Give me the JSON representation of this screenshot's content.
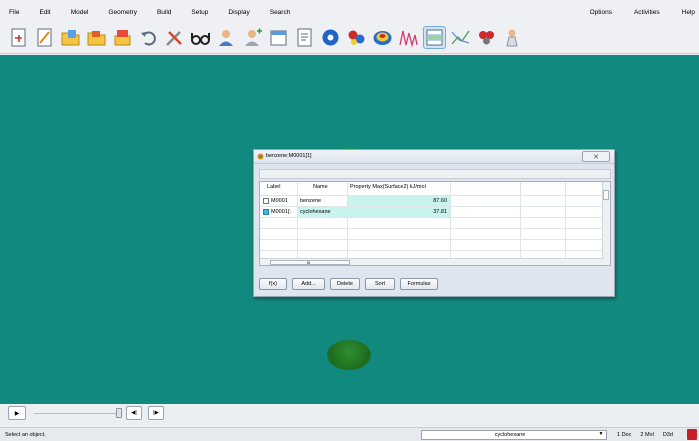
{
  "menu": {
    "left": [
      "File",
      "Edit",
      "Model",
      "Geometry",
      "Build",
      "Setup",
      "Display",
      "Search"
    ],
    "right": [
      "Options",
      "Activities",
      "Help"
    ]
  },
  "toolbar": {
    "icons": [
      "new-document-icon",
      "edit-icon",
      "open-folder-icon",
      "open-file-icon",
      "save-icon",
      "undo-icon",
      "tools-icon",
      "glasses-icon",
      "user-icon",
      "user-add-icon",
      "calendar-icon",
      "document-icon",
      "blue-sphere-icon",
      "molecule-icon",
      "surface-map-icon",
      "spectrum-icon",
      "table-icon",
      "graph-icon",
      "atoms-icon",
      "chemist-icon"
    ]
  },
  "dialog": {
    "title": "benzene:M0001[1]",
    "close_label": "✕",
    "columns": [
      "Label",
      "Name",
      "Property Max(Surface2) kJ/mol"
    ],
    "rows": [
      {
        "label": "M0001",
        "name": "benzene",
        "value": "87.60",
        "checked": false
      },
      {
        "label": "M0001[:",
        "name": "cyclohexane",
        "value": "37.81",
        "checked": true
      }
    ],
    "scroll_marker": "III",
    "buttons": [
      "f(x)",
      "Add...",
      "Delete",
      "Sort",
      "Formulas"
    ]
  },
  "controls": {
    "play": "▶",
    "prev": "◀|",
    "next": "|▶"
  },
  "status": {
    "message": "Select an object.",
    "combo_value": "cyclohexane",
    "combo_arrow": "▼",
    "docs": "1 Doc",
    "mols": "2 Mol",
    "mode": "D3d"
  }
}
